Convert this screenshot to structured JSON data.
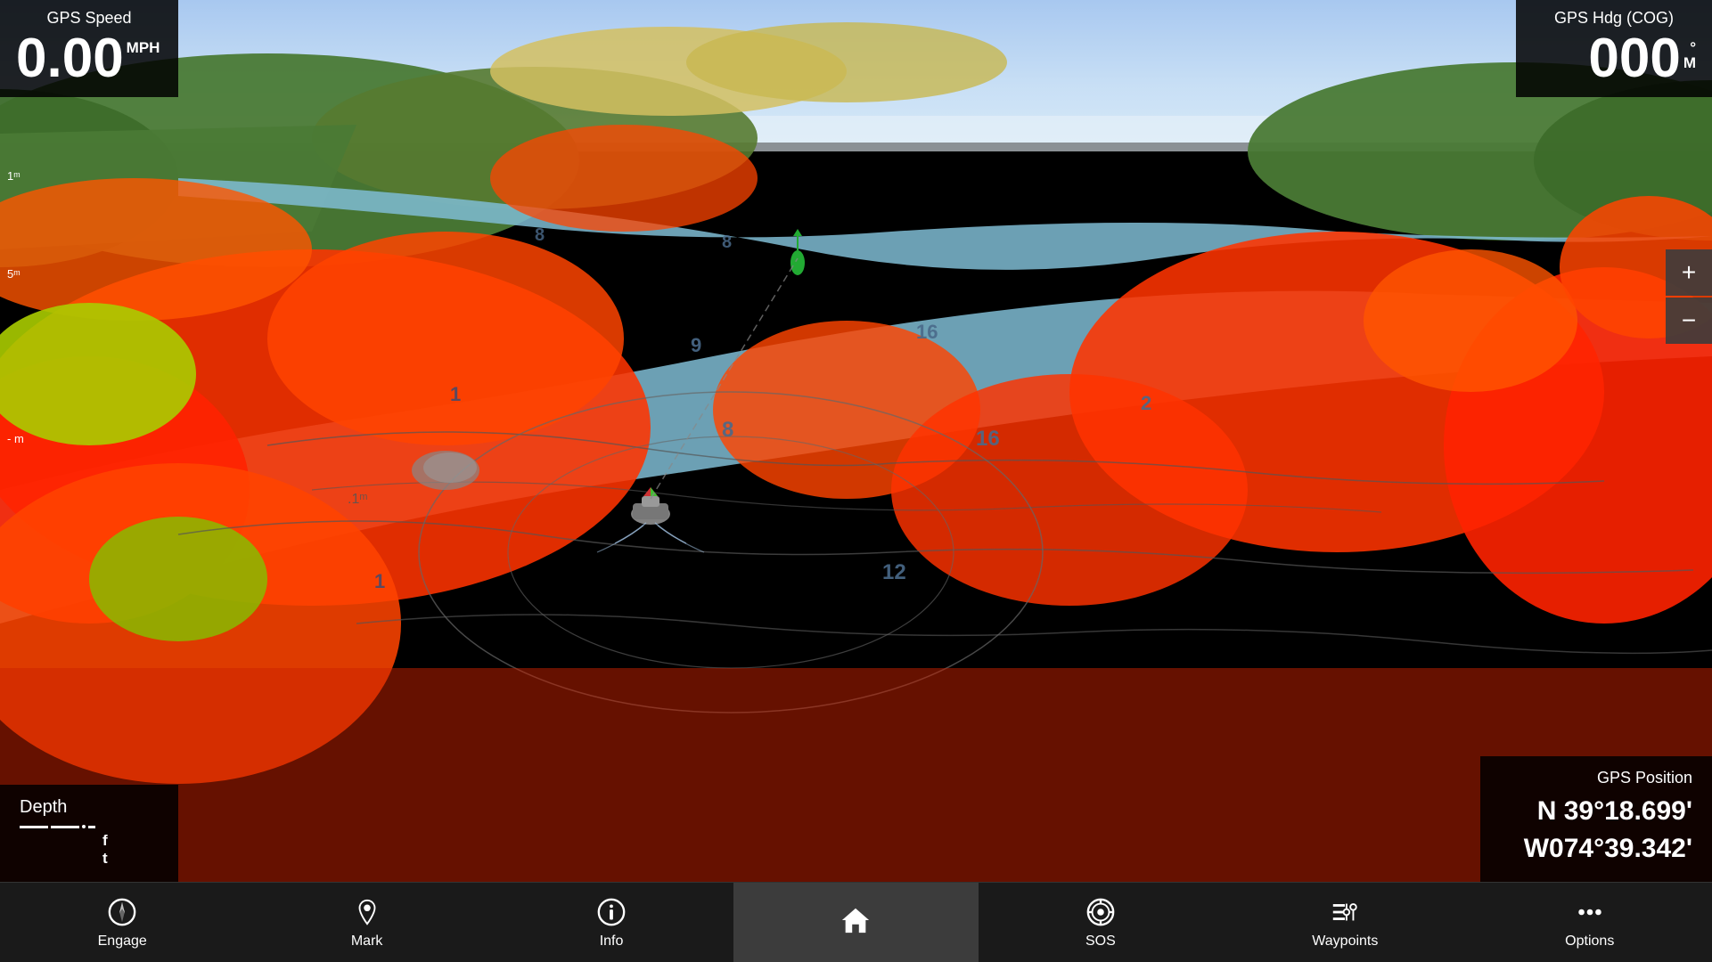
{
  "widgets": {
    "gps_speed": {
      "title": "GPS Speed",
      "value": "0.00",
      "unit_line1": "MPH",
      "unit_line2": ""
    },
    "gps_hdg": {
      "title": "GPS Hdg (COG)",
      "value": "000",
      "unit_line1": "°",
      "unit_line2": "M"
    },
    "depth": {
      "title": "Depth",
      "value": "---.-",
      "unit_f": "f",
      "unit_t": "t"
    },
    "gps_position": {
      "title": "GPS Position",
      "lat": "N  39°18.699'",
      "lon": "W074°39.342'"
    }
  },
  "scale": {
    "label1": "1ᵐ",
    "label2": "5ᵐ",
    "label3": "- m"
  },
  "map": {
    "depth_numbers": [
      "1",
      "1",
      "8",
      "9",
      "12",
      "16",
      "16",
      "2",
      "8",
      ".1ᵐ"
    ]
  },
  "nav_bar": {
    "items": [
      {
        "id": "engage",
        "label": "Engage",
        "icon": "compass"
      },
      {
        "id": "mark",
        "label": "Mark",
        "icon": "pin"
      },
      {
        "id": "info",
        "label": "Info",
        "icon": "info"
      },
      {
        "id": "home",
        "label": "",
        "icon": "home",
        "active": true
      },
      {
        "id": "sos",
        "label": "SOS",
        "icon": "sos"
      },
      {
        "id": "waypoints",
        "label": "Waypoints",
        "icon": "waypoints"
      },
      {
        "id": "options",
        "label": "Options",
        "icon": "dots"
      }
    ]
  },
  "zoom": {
    "plus_label": "+",
    "minus_label": "−"
  },
  "colors": {
    "accent": "#ffffff",
    "nav_bg": "#1a1a1a",
    "widget_bg": "rgba(0,0,0,0.85)"
  }
}
